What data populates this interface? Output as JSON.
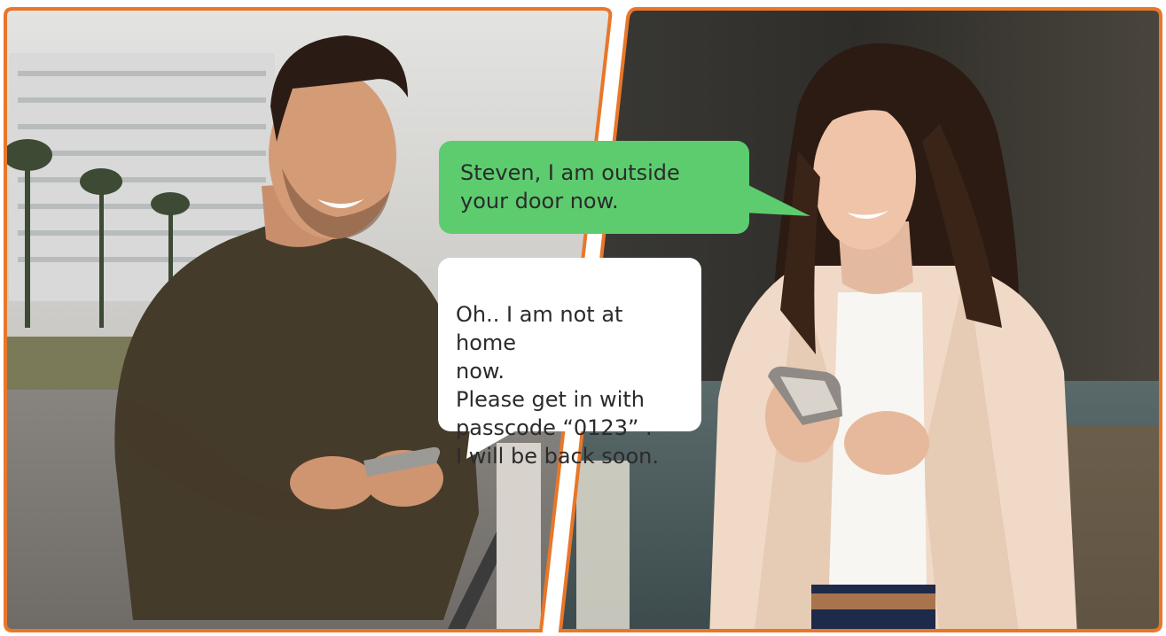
{
  "scene": {
    "frame_color": "#e8772a",
    "left_panel": "man in brown knit sweater smiling at smartphone on a seaside promenade",
    "right_panel": "woman in beige blazer smiling at smartphone indoors"
  },
  "messages": {
    "incoming": {
      "text": "Steven, I am outside your door now.",
      "color": "#5dcc6f"
    },
    "reply": {
      "text": "Oh.. I am not at home\nnow.\nPlease get in with\npasscode “0123” .\n I will be back soon.",
      "color": "#ffffff"
    }
  }
}
